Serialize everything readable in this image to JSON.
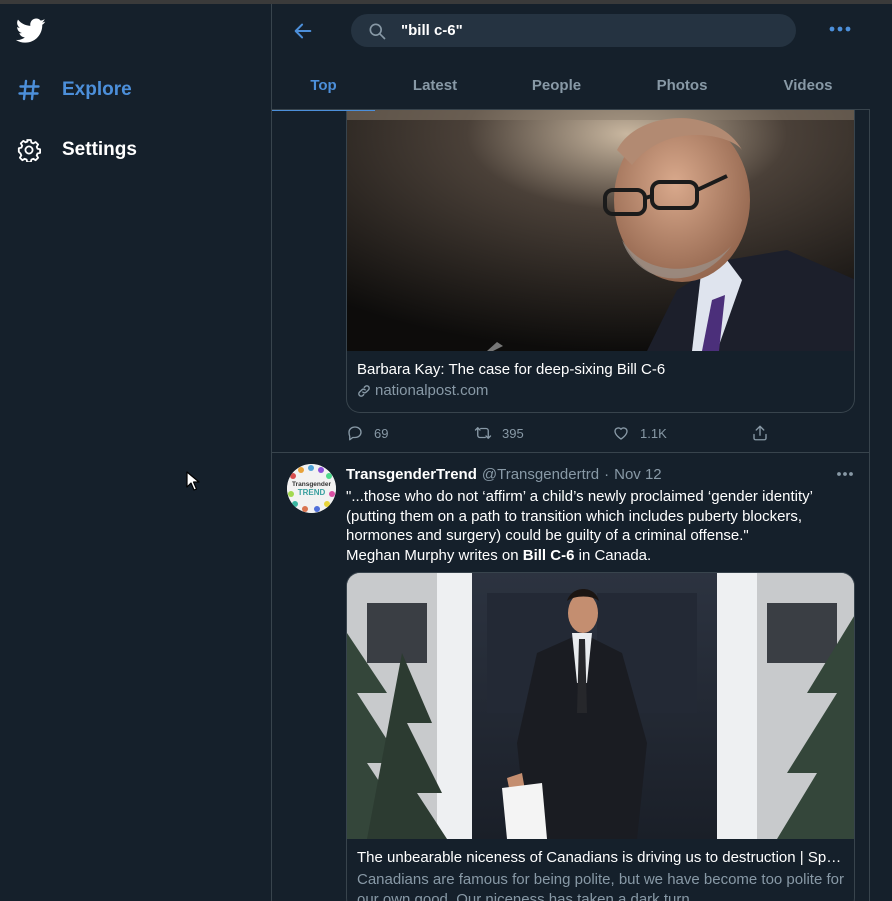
{
  "search": {
    "query": "\"bill c-6\""
  },
  "nav": {
    "items": [
      {
        "label": "Explore",
        "icon": "hashtag-icon"
      },
      {
        "label": "Settings",
        "icon": "gear-icon"
      }
    ]
  },
  "tabs": [
    "Top",
    "Latest",
    "People",
    "Photos",
    "Videos"
  ],
  "active_tab": "Top",
  "tweets": [
    {
      "card": {
        "title": "Barbara Kay: The case for deep-sixing Bill C-6",
        "domain": "nationalpost.com"
      },
      "stats": {
        "replies": "69",
        "retweets": "395",
        "likes": "1.1K"
      }
    },
    {
      "author": "TransgenderTrend",
      "handle": "@Transgendertrd",
      "dot": "·",
      "date": "Nov 12",
      "avatar_text": {
        "line1": "Transgender",
        "line2": "TREND"
      },
      "text": {
        "line1": "\"...those who do not ‘affirm’ a child’s newly proclaimed ‘gender identity’ (putting them on a path to transition which includes puberty blockers, hormones and surgery) could be guilty of a criminal offense.\"",
        "prefix": "Meghan Murphy writes on",
        "bold": "Bill C-6",
        "suffix": "in Canada."
      },
      "card": {
        "title": "The unbearable niceness of Canadians is driving us to destruction | Spec...",
        "description": "Canadians are famous for being polite, but we have become too polite for our own good. Our niceness has taken a dark turn."
      }
    }
  ],
  "colors": {
    "background": "#15202b",
    "accent": "#4c8fda",
    "muted": "#8899a6",
    "border": "#38444d"
  }
}
